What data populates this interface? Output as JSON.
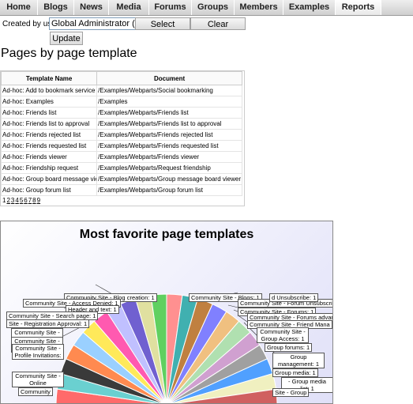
{
  "nav": {
    "tabs": [
      "Home",
      "Blogs",
      "News",
      "Media",
      "Forums",
      "Groups",
      "Members",
      "Examples",
      "Reports"
    ],
    "active": "Reports"
  },
  "filter": {
    "label": "Created by user:",
    "value": "Global Administrator (adm",
    "select_label": "Select",
    "clear_label": "Clear",
    "update_label": "Update"
  },
  "section_title": "Pages by page template",
  "table": {
    "headers": [
      "Template Name",
      "Document"
    ],
    "rows": [
      [
        "Ad-hoc: Add to bookmark service",
        "/Examples/Webparts/Social bookmarking"
      ],
      [
        "Ad-hoc: Examples",
        "/Examples"
      ],
      [
        "Ad-hoc: Friends list",
        "/Examples/Webparts/Friends list"
      ],
      [
        "Ad-hoc: Friends list to approval",
        "/Examples/Webparts/Friends list to approval"
      ],
      [
        "Ad-hoc: Friends rejected list",
        "/Examples/Webparts/Friends rejected list"
      ],
      [
        "Ad-hoc: Friends requested list",
        "/Examples/Webparts/Friends requested list"
      ],
      [
        "Ad-hoc: Friends viewer",
        "/Examples/Webparts/Friends viewer"
      ],
      [
        "Ad-hoc: Friendship request",
        "/Examples/Webparts/Request friendship"
      ],
      [
        "Ad-hoc: Group board message viewer",
        "/Examples/Webparts/Group message board viewer"
      ],
      [
        "Ad-hoc: Group forum list",
        "/Examples/Webparts/Group forum list"
      ]
    ],
    "pages": [
      "1",
      "2",
      "3",
      "4",
      "5",
      "6",
      "7",
      "8",
      "9"
    ]
  },
  "chart_data": {
    "type": "pie",
    "title": "Most favorite page templates",
    "labels": [
      "Community Site - Blog creation: 1",
      "Community Site - Access Denied: 1",
      "Header and text: 1",
      "Community Site - Search page: 1",
      "Site - Registration Approval: 1",
      "Community Site - Profile",
      "Community Site - Profile Manage",
      "Community Site - Profile Invitations:",
      "Community Site - Online",
      "Community",
      "Community Site - Blogs: 1",
      "Community Site - Forum Unsubscribe: 1",
      "d Unsubscribe: 1",
      "Community Site - Forums: 1",
      "Community Site - Forums advance",
      "Community Site - Friend Mana",
      "Community Site - Group Access: 1",
      "Group forums: 1",
      "Group management: 1",
      "Group media: 1",
      "- Group media list: 1",
      "Site - Group"
    ],
    "colors": [
      "#ff6a6a",
      "#6ad0d0",
      "#3a3a3a",
      "#ff8a50",
      "#9ad0ff",
      "#ffe95a",
      "#ff5ab0",
      "#c0c0ff",
      "#7060d0",
      "#e0e0a0",
      "#60d060",
      "#ff9090",
      "#40b0b0",
      "#c08040",
      "#8080ff",
      "#f0c080",
      "#b0e0b0",
      "#d0a0d0",
      "#a0a0a0",
      "#50a0ff",
      "#f0f0c0",
      "#d06060"
    ]
  }
}
